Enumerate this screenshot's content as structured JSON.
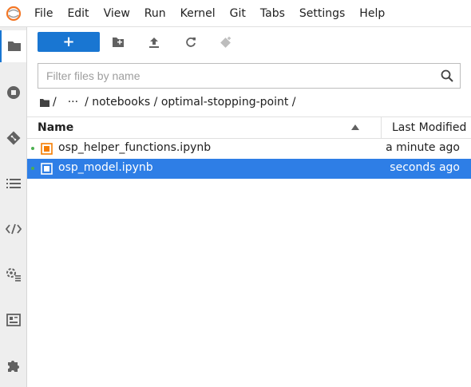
{
  "menubar": {
    "logo_icon": "jupyter-logo-icon",
    "items": [
      "File",
      "Edit",
      "View",
      "Run",
      "Kernel",
      "Git",
      "Tabs",
      "Settings",
      "Help"
    ]
  },
  "sidebar": {
    "items": [
      {
        "icon": "folder-icon",
        "active": true
      },
      {
        "icon": "stop-circle-icon"
      },
      {
        "icon": "git-icon"
      },
      {
        "icon": "list-icon"
      },
      {
        "icon": "code-icon"
      },
      {
        "icon": "property-inspector-icon"
      },
      {
        "icon": "build-icon"
      },
      {
        "icon": "extension-puzzle-icon"
      }
    ]
  },
  "toolbar": {
    "new_label": "+",
    "accent": "#1976d2"
  },
  "filter": {
    "placeholder": "Filter files by name",
    "value": ""
  },
  "breadcrumb": {
    "root": "/",
    "ellipsis": "···",
    "path": "/ notebooks / optimal-stopping-point /"
  },
  "table": {
    "columns": {
      "name": "Name",
      "modified": "Last Modified"
    },
    "rows": [
      {
        "name": "osp_helper_functions.ipynb",
        "modified": "a minute ago",
        "selected": false,
        "running": true
      },
      {
        "name": "osp_model.ipynb",
        "modified": "seconds ago",
        "selected": true,
        "running": true
      }
    ]
  },
  "colors": {
    "selection": "#2e7ee6",
    "notebook_icon": "#f57c00",
    "running_dot": "#4caf50"
  }
}
